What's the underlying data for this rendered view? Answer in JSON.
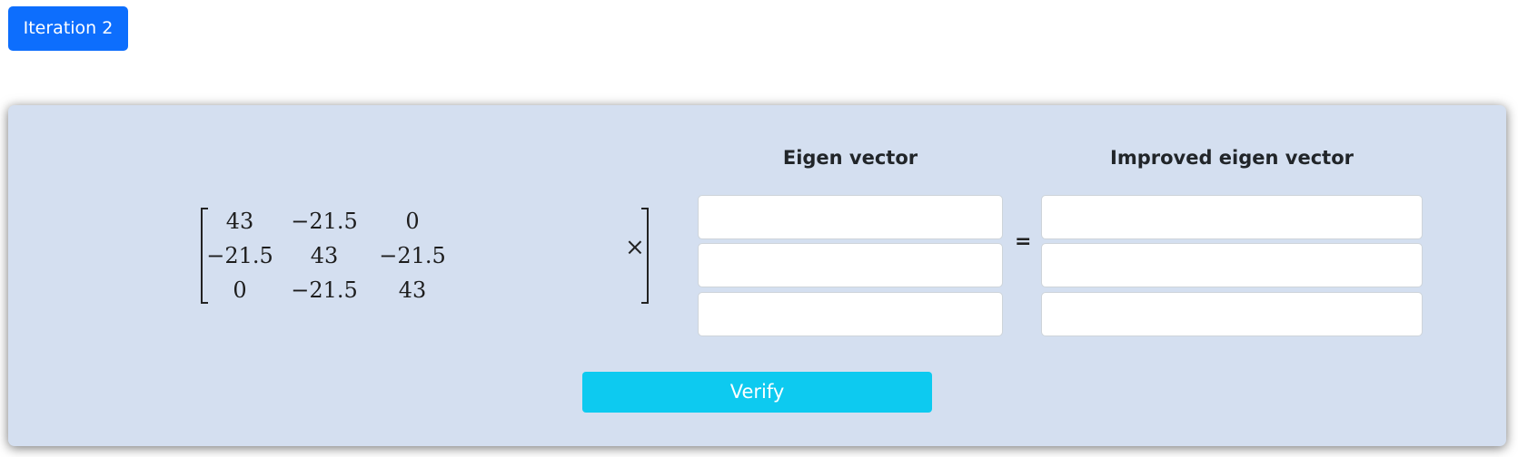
{
  "header": {
    "iteration_label": "Iteration 2"
  },
  "colors": {
    "primary_button": "#0d6efd",
    "panel_background": "#d4dff0",
    "verify_button": "#0dcaf0"
  },
  "matrix": {
    "rows": [
      [
        "43",
        "−21.5",
        "0"
      ],
      [
        "−21.5",
        "43",
        "−21.5"
      ],
      [
        "0",
        "−21.5",
        "43"
      ]
    ]
  },
  "operators": {
    "times": "×",
    "equals": "="
  },
  "eigen_vector": {
    "heading": "Eigen vector",
    "values": [
      "",
      "",
      ""
    ]
  },
  "improved_eigen_vector": {
    "heading": "Improved eigen vector",
    "values": [
      "",
      "",
      ""
    ]
  },
  "actions": {
    "verify_label": "Verify"
  }
}
